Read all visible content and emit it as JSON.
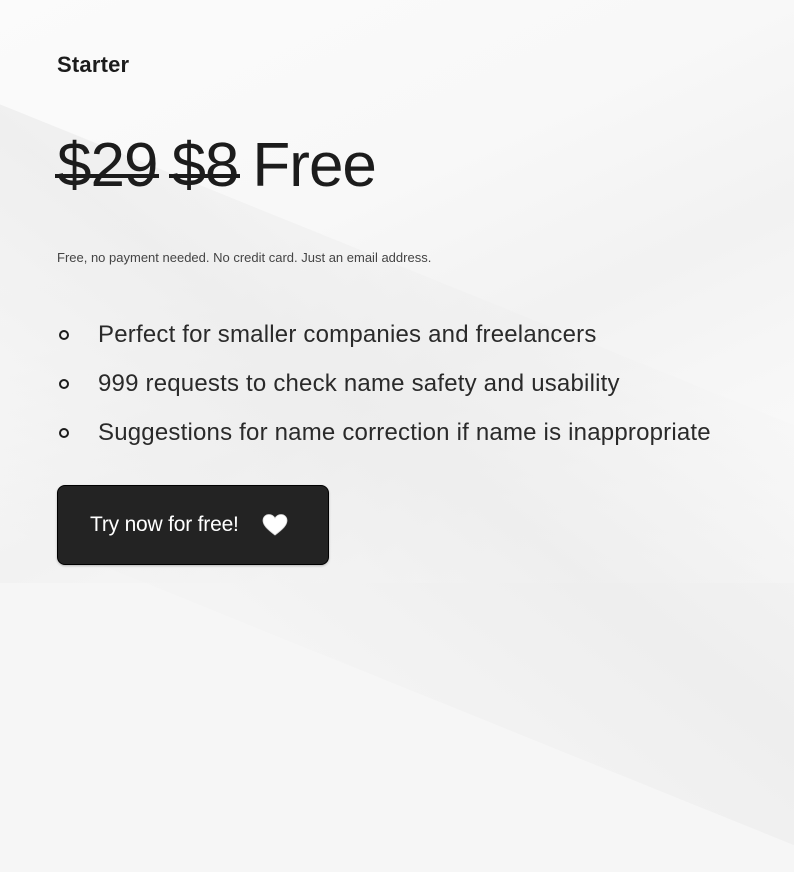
{
  "plan": {
    "name": "Starter",
    "old_prices": [
      "$29",
      "$8"
    ],
    "current_price": "Free",
    "note": "Free, no payment needed. No credit card. Just an email address."
  },
  "features": [
    "Perfect for smaller companies and freelancers",
    "999 requests to check name safety and usability",
    "Suggestions for name correction if name is inappropriate"
  ],
  "cta": {
    "label": "Try now for free!",
    "icon": "heart-icon"
  },
  "colors": {
    "text": "#1c1c1c",
    "button_bg": "#232323",
    "button_text": "#ffffff",
    "background": "#f6f6f6"
  }
}
